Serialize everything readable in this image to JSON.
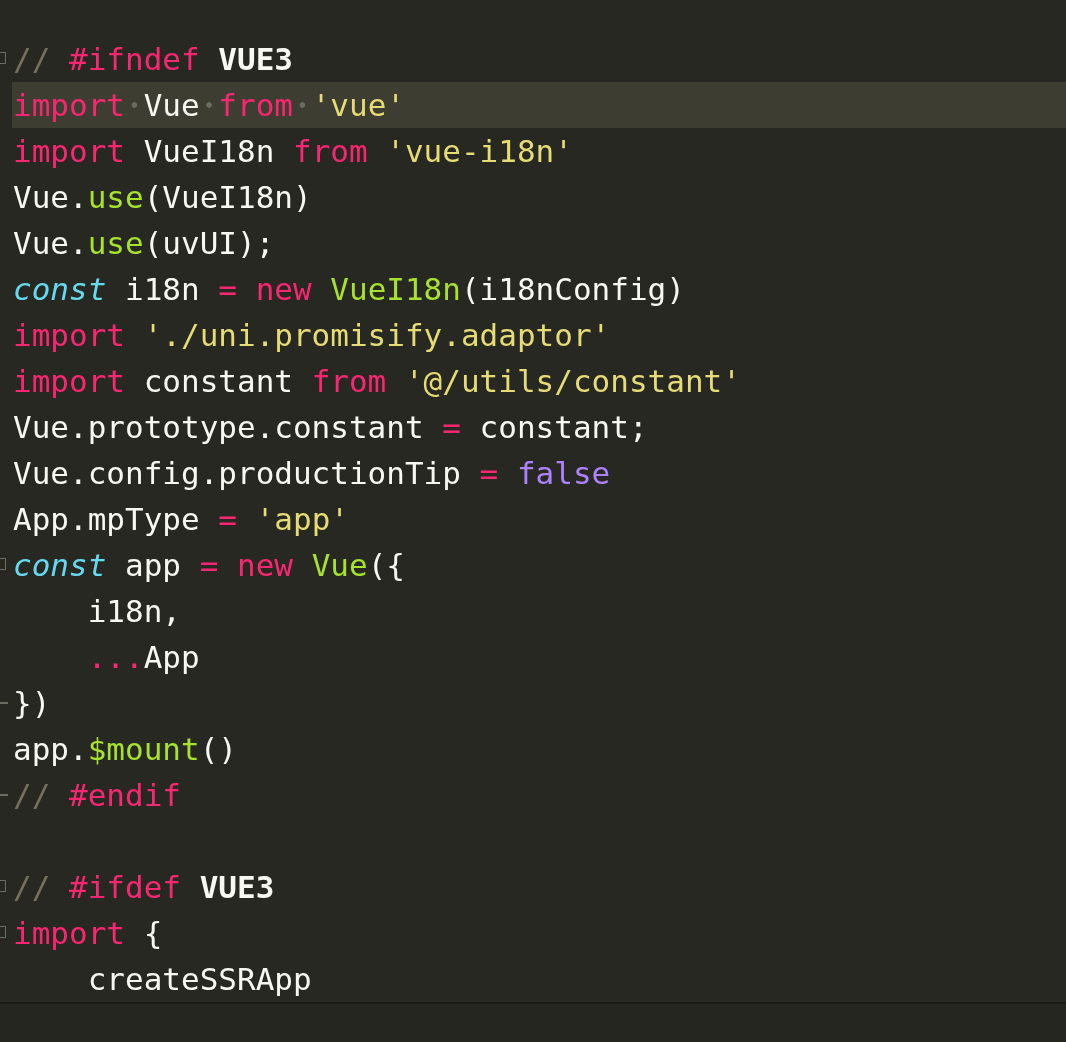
{
  "editor": {
    "lines": [
      {
        "fold_start": true,
        "fold_end": false,
        "current": false,
        "tokens": [
          {
            "text": "// ",
            "kind": "comment"
          },
          {
            "text": "#ifndef ",
            "kind": "keyword"
          },
          {
            "text": "VUE3",
            "kind": "bold"
          }
        ]
      },
      {
        "fold_start": false,
        "fold_end": false,
        "current": true,
        "tokens": [
          {
            "text": "import",
            "kind": "keyword"
          },
          {
            "text": " Vue ",
            "kind": "text"
          },
          {
            "text": "from",
            "kind": "keyword"
          },
          {
            "text": " 'vue'",
            "kind": "string"
          }
        ]
      },
      {
        "fold_start": false,
        "fold_end": false,
        "current": false,
        "tokens": [
          {
            "text": "import",
            "kind": "keyword"
          },
          {
            "text": " VueI18n ",
            "kind": "text"
          },
          {
            "text": "from",
            "kind": "keyword"
          },
          {
            "text": " 'vue-i18n'",
            "kind": "string"
          }
        ]
      },
      {
        "fold_start": false,
        "fold_end": false,
        "current": false,
        "tokens": [
          {
            "text": "Vue.",
            "kind": "text"
          },
          {
            "text": "use",
            "kind": "func"
          },
          {
            "text": "(VueI18n)",
            "kind": "text"
          }
        ]
      },
      {
        "fold_start": false,
        "fold_end": false,
        "current": false,
        "tokens": [
          {
            "text": "Vue.",
            "kind": "text"
          },
          {
            "text": "use",
            "kind": "func"
          },
          {
            "text": "(uvUI);",
            "kind": "text"
          }
        ]
      },
      {
        "fold_start": false,
        "fold_end": false,
        "current": false,
        "tokens": [
          {
            "text": "const",
            "kind": "storage"
          },
          {
            "text": " i18n ",
            "kind": "text"
          },
          {
            "text": "= new",
            "kind": "keyword"
          },
          {
            "text": " VueI18n",
            "kind": "func"
          },
          {
            "text": "(i18nConfig)",
            "kind": "text"
          }
        ]
      },
      {
        "fold_start": false,
        "fold_end": false,
        "current": false,
        "tokens": [
          {
            "text": "import",
            "kind": "keyword"
          },
          {
            "text": " './uni.promisify.adaptor'",
            "kind": "string"
          }
        ]
      },
      {
        "fold_start": false,
        "fold_end": false,
        "current": false,
        "tokens": [
          {
            "text": "import",
            "kind": "keyword"
          },
          {
            "text": " constant ",
            "kind": "text"
          },
          {
            "text": "from",
            "kind": "keyword"
          },
          {
            "text": " '@/utils/constant'",
            "kind": "string"
          }
        ]
      },
      {
        "fold_start": false,
        "fold_end": false,
        "current": false,
        "tokens": [
          {
            "text": "Vue.prototype.constant ",
            "kind": "text"
          },
          {
            "text": "=",
            "kind": "keyword"
          },
          {
            "text": " constant;",
            "kind": "text"
          }
        ]
      },
      {
        "fold_start": false,
        "fold_end": false,
        "current": false,
        "tokens": [
          {
            "text": "Vue.config.productionTip ",
            "kind": "text"
          },
          {
            "text": "=",
            "kind": "keyword"
          },
          {
            "text": " false",
            "kind": "constant"
          }
        ]
      },
      {
        "fold_start": false,
        "fold_end": false,
        "current": false,
        "tokens": [
          {
            "text": "App.mpType ",
            "kind": "text"
          },
          {
            "text": "=",
            "kind": "keyword"
          },
          {
            "text": " 'app'",
            "kind": "string"
          }
        ]
      },
      {
        "fold_start": true,
        "fold_end": false,
        "current": false,
        "tokens": [
          {
            "text": "const",
            "kind": "storage"
          },
          {
            "text": " app ",
            "kind": "text"
          },
          {
            "text": "= new",
            "kind": "keyword"
          },
          {
            "text": " Vue",
            "kind": "func"
          },
          {
            "text": "({",
            "kind": "text"
          }
        ]
      },
      {
        "fold_start": false,
        "fold_end": false,
        "current": false,
        "tokens": [
          {
            "text": "    i18n,",
            "kind": "text"
          }
        ]
      },
      {
        "fold_start": false,
        "fold_end": false,
        "current": false,
        "tokens": [
          {
            "text": "    ...",
            "kind": "keyword"
          },
          {
            "text": "App",
            "kind": "text"
          }
        ]
      },
      {
        "fold_start": false,
        "fold_end": true,
        "current": false,
        "tokens": [
          {
            "text": "})",
            "kind": "text"
          }
        ]
      },
      {
        "fold_start": false,
        "fold_end": false,
        "current": false,
        "tokens": [
          {
            "text": "app.",
            "kind": "text"
          },
          {
            "text": "$mount",
            "kind": "func"
          },
          {
            "text": "()",
            "kind": "text"
          }
        ]
      },
      {
        "fold_start": false,
        "fold_end": true,
        "current": false,
        "tokens": [
          {
            "text": "// ",
            "kind": "comment"
          },
          {
            "text": "#endif",
            "kind": "keyword"
          }
        ]
      },
      {
        "fold_start": false,
        "fold_end": false,
        "current": false
      },
      {
        "fold_start": true,
        "fold_end": false,
        "current": false,
        "tokens": [
          {
            "text": "// ",
            "kind": "comment"
          },
          {
            "text": "#ifdef ",
            "kind": "keyword"
          },
          {
            "text": "VUE3",
            "kind": "bold"
          }
        ]
      },
      {
        "fold_start": true,
        "fold_end": false,
        "current": false,
        "tokens": [
          {
            "text": "import",
            "kind": "keyword"
          },
          {
            "text": " {",
            "kind": "text"
          }
        ]
      },
      {
        "fold_start": false,
        "fold_end": false,
        "current": false,
        "tokens": [
          {
            "text": "    createSSRApp",
            "kind": "text"
          }
        ]
      }
    ]
  }
}
